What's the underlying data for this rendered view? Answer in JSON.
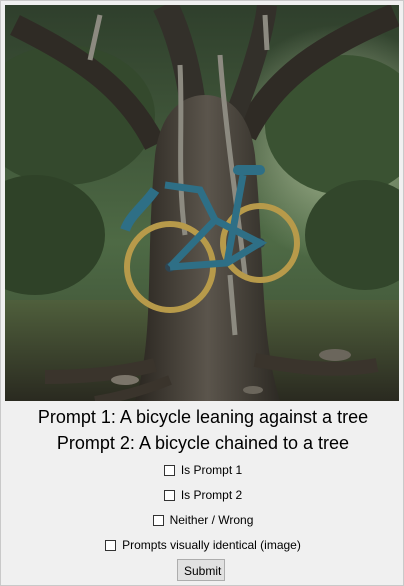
{
  "prompts": {
    "prompt1": "Prompt 1: A bicycle leaning against a tree",
    "prompt2": "Prompt 2: A bicycle chained to a tree"
  },
  "options": {
    "is_prompt_1": "Is Prompt 1",
    "is_prompt_2": "Is Prompt 2",
    "neither": "Neither / Wrong",
    "identical": "Prompts visually identical (image)"
  },
  "actions": {
    "submit": "Submit"
  },
  "colors": {
    "window_bg": "#f0f0f0",
    "button_bg": "#e1e1e1"
  }
}
